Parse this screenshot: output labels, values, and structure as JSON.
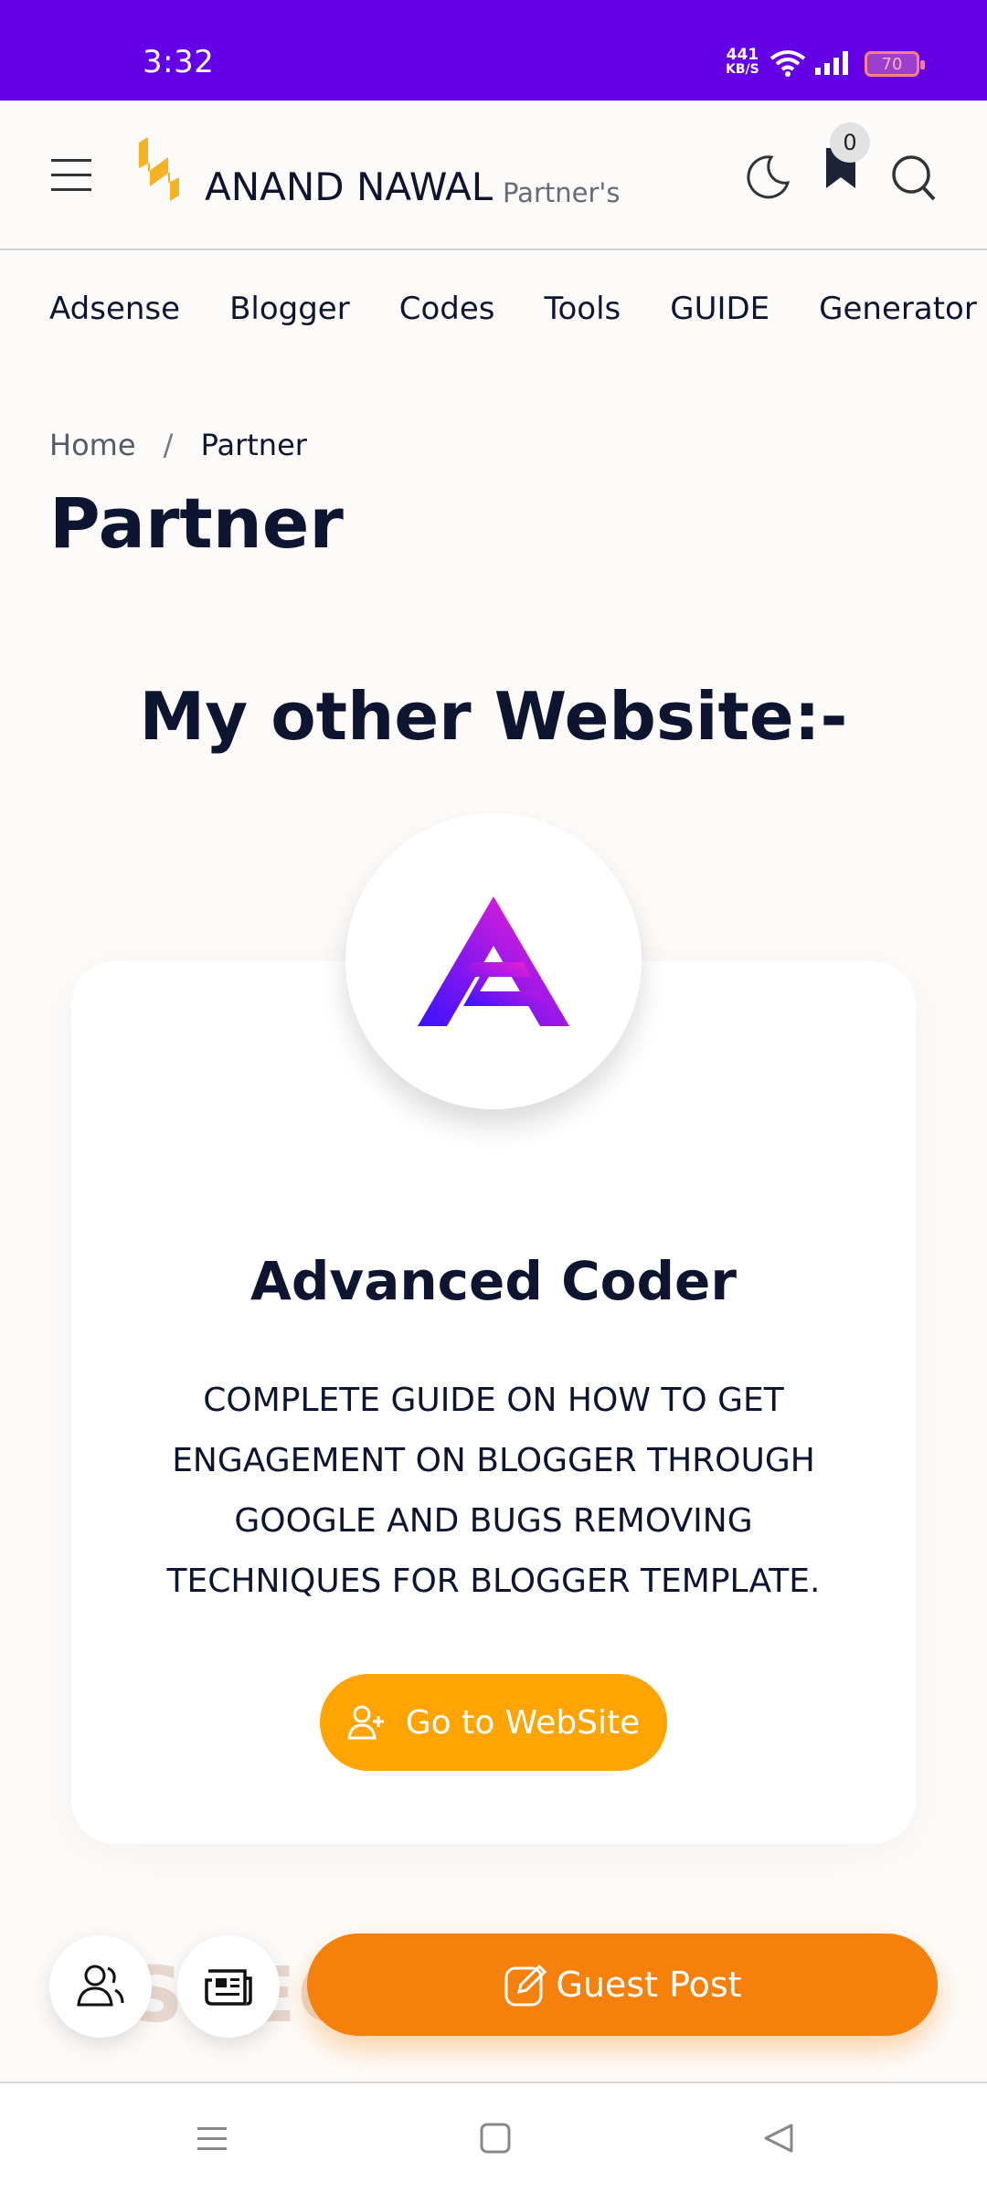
{
  "status_bar": {
    "time": "3:32",
    "speed_value": "441",
    "speed_unit": "KB/S",
    "battery": "70"
  },
  "header": {
    "title": "ANAND NAWAL",
    "subtitle": "Partner's",
    "bookmark_count": "0"
  },
  "nav": {
    "items": [
      "Adsense",
      "Blogger",
      "Codes",
      "Tools",
      "GUIDE",
      "Generator"
    ]
  },
  "breadcrumb": {
    "home": "Home",
    "separator": "/",
    "current": "Partner"
  },
  "page": {
    "title": "Partner",
    "section_title": "My other Website:-"
  },
  "card": {
    "title": "Advanced Coder",
    "description": "COMPLETE GUIDE ON HOW TO GET ENGAGEMENT ON BLOGGER THROUGH GOOGLE AND BUGS REMOVING TECHNIQUES FOR BLOGGER TEMPLATE.",
    "button_label": "Go to WebSite"
  },
  "footer": {
    "faded_text": "SPECI",
    "guest_post_label": "Guest Post"
  },
  "colors": {
    "status_bar": "#6400e6",
    "cta": "#ffa400",
    "guest_post": "#f6800c",
    "logo_gold": "#f5b324"
  },
  "icons": [
    "menu-icon",
    "logo-icon",
    "moon-icon",
    "bookmark-icon",
    "search-icon",
    "add-user-icon",
    "users-icon",
    "news-icon",
    "edit-icon"
  ]
}
